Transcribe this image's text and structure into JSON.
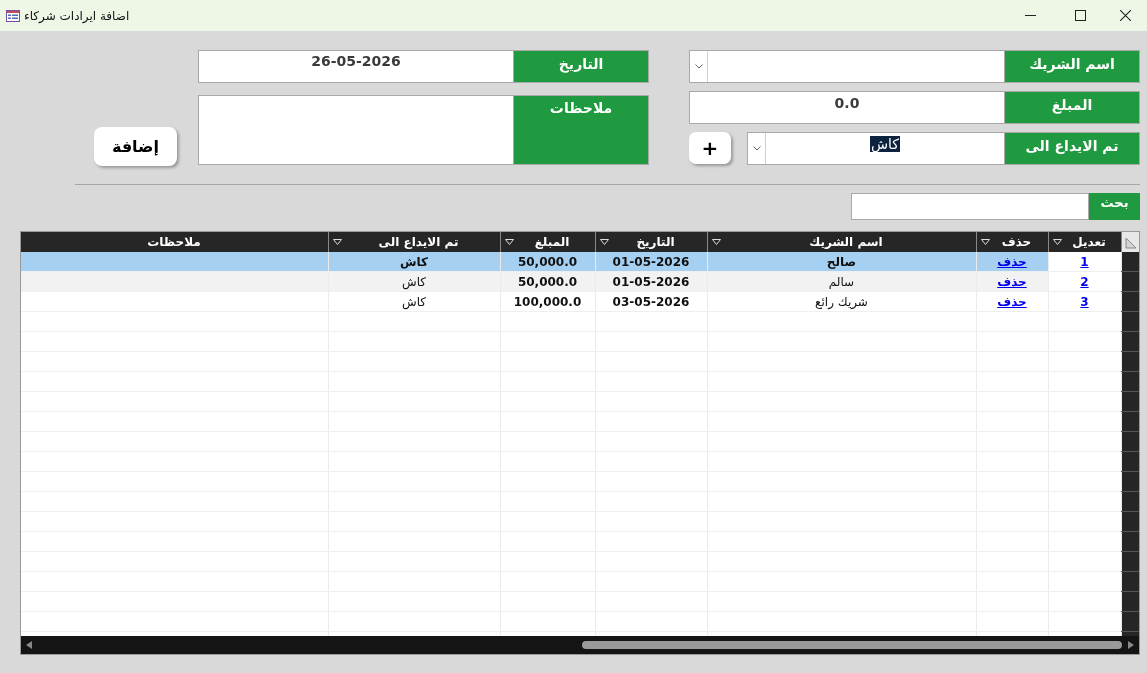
{
  "window": {
    "title": "اضافة ايرادات شركاء"
  },
  "partner_field": {
    "label": "اسم الشريك"
  },
  "amount_field": {
    "label": "المبلغ",
    "value": "0.0"
  },
  "deposit_field": {
    "label": "تم الايداع الى",
    "value": "كاش",
    "highlighted": true
  },
  "add_option_button": "+",
  "date_field": {
    "label": "التاريخ",
    "value": "26-05-2026"
  },
  "notes_field": {
    "label": "ملاحظات"
  },
  "add_button": "إضافة",
  "search": {
    "label": "بحث"
  },
  "table": {
    "columns": [
      {
        "label": "تعديل",
        "filter": true
      },
      {
        "label": "حذف",
        "filter": true
      },
      {
        "label": "اسم الشريك",
        "filter": true
      },
      {
        "label": "التاريخ",
        "filter": true
      },
      {
        "label": "المبلغ",
        "filter": true
      },
      {
        "label": "تم الايداع الى",
        "filter": true
      },
      {
        "label": "ملاحظات",
        "filter": false
      }
    ],
    "rows": [
      {
        "edit": "1",
        "delete": "حذف",
        "partner": "صالح",
        "date": "01-05-2026",
        "amount": "50,000.0",
        "deposit": "كاش",
        "selected": true
      },
      {
        "edit": "2",
        "delete": "حذف",
        "partner": "سالم",
        "date": "01-05-2026",
        "amount": "50,000.0",
        "deposit": "كاش",
        "selected": false
      },
      {
        "edit": "3",
        "delete": "حذف",
        "partner": "شريك رائع",
        "date": "03-05-2026",
        "amount": "100,000.0",
        "deposit": "كاش",
        "selected": false
      }
    ]
  }
}
